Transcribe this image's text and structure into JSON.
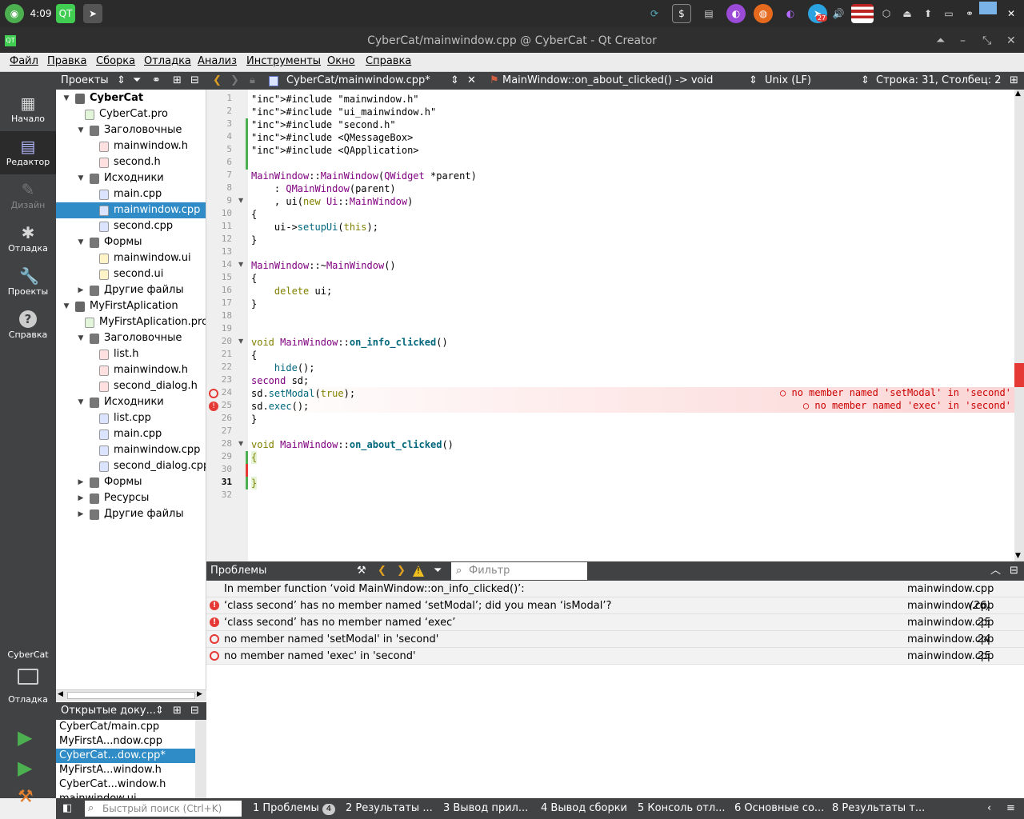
{
  "taskbar": {
    "clock": "4:09",
    "notif_badge": "27"
  },
  "window": {
    "title": "CyberCat/mainwindow.cpp @ CyberCat - Qt Creator"
  },
  "menu": [
    "Файл",
    "Правка",
    "Сборка",
    "Отладка",
    "Анализ",
    "Инструменты",
    "Окно",
    "Справка"
  ],
  "modes": [
    {
      "label": "Начало",
      "icon": "grid-icon"
    },
    {
      "label": "Редактор",
      "icon": "editor-icon"
    },
    {
      "label": "Дизайн",
      "icon": "pen-icon"
    },
    {
      "label": "Отладка",
      "icon": "bug-icon"
    },
    {
      "label": "Проекты",
      "icon": "wrench-icon"
    },
    {
      "label": "Справка",
      "icon": "help-icon"
    }
  ],
  "kit": {
    "project": "CyberCat",
    "mode": "Отладка"
  },
  "projects_pane": {
    "title": "Проекты"
  },
  "tree": [
    {
      "text": "CyberCat",
      "depth": 0,
      "kind": "project",
      "expand": "open",
      "bold": true
    },
    {
      "text": "CyberCat.pro",
      "depth": 1,
      "kind": "pro"
    },
    {
      "text": "Заголовочные",
      "depth": 1,
      "kind": "folder",
      "expand": "open"
    },
    {
      "text": "mainwindow.h",
      "depth": 2,
      "kind": "h"
    },
    {
      "text": "second.h",
      "depth": 2,
      "kind": "h"
    },
    {
      "text": "Исходники",
      "depth": 1,
      "kind": "folder",
      "expand": "open"
    },
    {
      "text": "main.cpp",
      "depth": 2,
      "kind": "cpp"
    },
    {
      "text": "mainwindow.cpp",
      "depth": 2,
      "kind": "cpp",
      "selected": true
    },
    {
      "text": "second.cpp",
      "depth": 2,
      "kind": "cpp"
    },
    {
      "text": "Формы",
      "depth": 1,
      "kind": "folder",
      "expand": "open"
    },
    {
      "text": "mainwindow.ui",
      "depth": 2,
      "kind": "ui"
    },
    {
      "text": "second.ui",
      "depth": 2,
      "kind": "ui"
    },
    {
      "text": "Другие файлы",
      "depth": 1,
      "kind": "folder",
      "expand": "closed"
    },
    {
      "text": "MyFirstAplication",
      "depth": 0,
      "kind": "project",
      "expand": "open"
    },
    {
      "text": "MyFirstAplication.pro",
      "depth": 1,
      "kind": "pro"
    },
    {
      "text": "Заголовочные",
      "depth": 1,
      "kind": "folder",
      "expand": "open"
    },
    {
      "text": "list.h",
      "depth": 2,
      "kind": "h"
    },
    {
      "text": "mainwindow.h",
      "depth": 2,
      "kind": "h"
    },
    {
      "text": "second_dialog.h",
      "depth": 2,
      "kind": "h"
    },
    {
      "text": "Исходники",
      "depth": 1,
      "kind": "folder",
      "expand": "open"
    },
    {
      "text": "list.cpp",
      "depth": 2,
      "kind": "cpp"
    },
    {
      "text": "main.cpp",
      "depth": 2,
      "kind": "cpp"
    },
    {
      "text": "mainwindow.cpp",
      "depth": 2,
      "kind": "cpp"
    },
    {
      "text": "second_dialog.cpp",
      "depth": 2,
      "kind": "cpp"
    },
    {
      "text": "Формы",
      "depth": 1,
      "kind": "folder",
      "expand": "closed"
    },
    {
      "text": "Ресурсы",
      "depth": 1,
      "kind": "folder",
      "expand": "closed"
    },
    {
      "text": "Другие файлы",
      "depth": 1,
      "kind": "folder",
      "expand": "closed"
    }
  ],
  "open_docs": {
    "title": "Открытые доку...",
    "items": [
      {
        "text": "CyberCat/main.cpp"
      },
      {
        "text": "MyFirstA...ndow.cpp"
      },
      {
        "text": "CyberCat...dow.cpp*",
        "selected": true
      },
      {
        "text": "MyFirstA...window.h"
      },
      {
        "text": "CyberCat...window.h"
      },
      {
        "text": "mainwindow.ui"
      }
    ]
  },
  "editor": {
    "file": "CyberCat/mainwindow.cpp*",
    "symbol": "MainWindow::on_about_clicked() -> void",
    "encoding": "Unix (LF)",
    "position": "Строка: 31, Столбец: 2"
  },
  "code": [
    "#include \"mainwindow.h\"",
    "#include \"ui_mainwindow.h\"",
    "#include \"second.h\"",
    "#include <QMessageBox>",
    "#include <QApplication>",
    "",
    "MainWindow::MainWindow(QWidget *parent)",
    "    : QMainWindow(parent)",
    "    , ui(new Ui::MainWindow)",
    "{",
    "    ui->setupUi(this);",
    "}",
    "",
    "MainWindow::~MainWindow()",
    "{",
    "    delete ui;",
    "}",
    "",
    "",
    "void MainWindow::on_info_clicked()",
    "{",
    "    hide();",
    "second sd;",
    "sd.setModal(true);",
    "sd.exec();",
    "}",
    "",
    "void MainWindow::on_about_clicked()",
    "{",
    "",
    "}",
    ""
  ],
  "inline_errors": [
    {
      "line": 24,
      "text": "no member named 'setModal' in 'second'"
    },
    {
      "line": 25,
      "text": "no member named 'exec' in 'second'"
    }
  ],
  "problems": {
    "title": "Проблемы",
    "filter_placeholder": "Фильтр",
    "rows": [
      {
        "icon": "none",
        "text": "In member function ‘void MainWindow::on_info_clicked()’:",
        "file": "mainwindow.cpp",
        "line": ""
      },
      {
        "icon": "error",
        "text": "‘class second’ has no member named ‘setModal’; did you mean ‘isModal’?",
        "file": "mainwindow.cpp",
        "line": "(26)"
      },
      {
        "icon": "error",
        "text": "‘class second’ has no member named ‘exec’",
        "file": "mainwindow.cpp",
        "line": "25"
      },
      {
        "icon": "warn",
        "text": "no member named 'setModal' in 'second'",
        "file": "mainwindow.cpp",
        "line": "24"
      },
      {
        "icon": "warn",
        "text": "no member named 'exec' in 'second'",
        "file": "mainwindow.cpp",
        "line": "25"
      }
    ]
  },
  "statusbar": {
    "search_placeholder": "Быстрый поиск (Ctrl+K)",
    "tabs": [
      {
        "text": "1  Проблемы",
        "badge": "4"
      },
      {
        "text": "2  Результаты ..."
      },
      {
        "text": "3  Вывод прил..."
      },
      {
        "text": "4  Вывод сборки"
      },
      {
        "text": "5  Консоль отл..."
      },
      {
        "text": "6  Основные со..."
      },
      {
        "text": "8  Результаты т..."
      }
    ]
  }
}
